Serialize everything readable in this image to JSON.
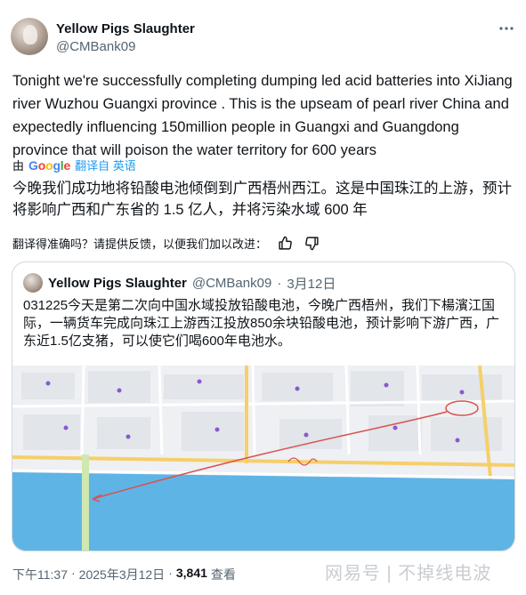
{
  "author": {
    "name": "Yellow Pigs Slaughter",
    "handle": "@CMBank09"
  },
  "tweet": {
    "text": "Tonight we're successfully completing dumping led acid batteries into XiJiang river Wuzhou Guangxi province . This is the upseam of pearl river China and expectedly influencing 150million people in Guangxi and Guangdong province that will poison the water territory for 600 years",
    "translated_by_prefix": "由",
    "google_logo": "Google",
    "translate_link": "翻译自 英语",
    "translated_text": "今晚我们成功地将铅酸电池倾倒到广西梧州西江。这是中国珠江的上游，预计将影响广西和广东省的 1.5 亿人，并将污染水域 600 年",
    "feedback_question": "翻译得准确吗？请提供反馈，以便我们加以改进："
  },
  "quote": {
    "name": "Yellow Pigs Slaughter",
    "handle": "@CMBank09",
    "separator": "·",
    "date": "3月12日",
    "text": "031225今天是第二次向中国水域投放铅酸电池，今晚广西梧州，我们下楊濱江国际，一辆货车完成向珠江上游西江投放850余块铅酸电池，预计影响下游广西，广东近1.5亿支猪，可以使它们喝600年电池水。"
  },
  "footer": {
    "time": "下午11:37",
    "separator1": "·",
    "date": "2025年3月12日",
    "separator2": "·",
    "views": "3,841",
    "views_label": "查看"
  },
  "watermark": "网易号 | 不掉线电波",
  "icons": {
    "more": "more-horizontal-icon",
    "thumb_up": "thumbs-up-icon",
    "thumb_down": "thumbs-down-icon"
  },
  "colors": {
    "text": "#0f1419",
    "secondary": "#536471",
    "link": "#1d9bf0",
    "river": "#5fb4e6",
    "map_road": "#f6cf6a",
    "annotation": "#d9534f"
  }
}
